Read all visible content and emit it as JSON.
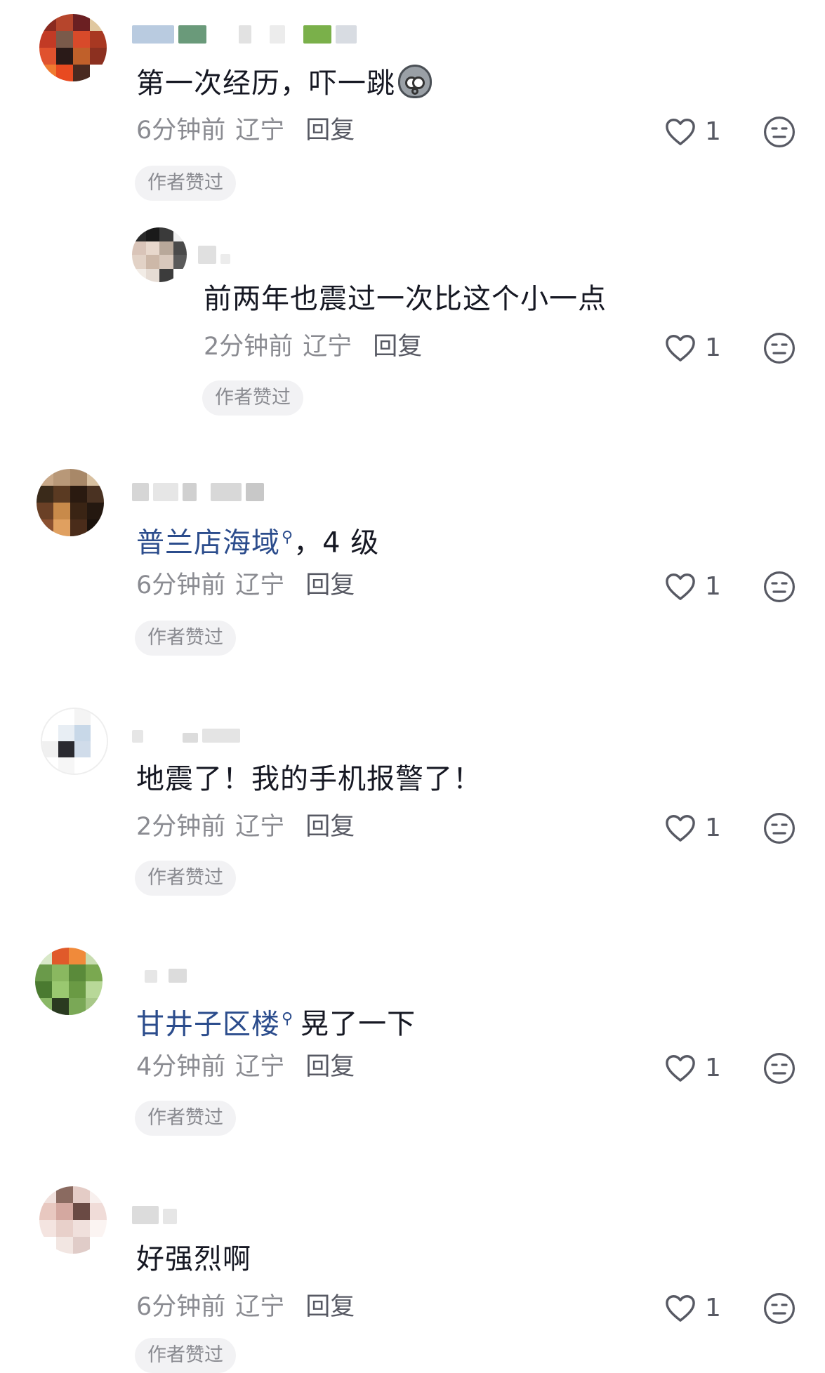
{
  "comments": [
    {
      "text": "第一次经历，吓一跳",
      "emoji_icon": "scared-face-emoji",
      "time": "6分钟前",
      "location": "辽宁",
      "reply_label": "回复",
      "like_count": "1",
      "author_liked": "作者赞过"
    },
    {
      "text": "前两年也震过一次比这个小一点",
      "time": "2分钟前",
      "location": "辽宁",
      "reply_label": "回复",
      "like_count": "1",
      "author_liked": "作者赞过"
    },
    {
      "keyword": "普兰店海域",
      "text": "，4 级",
      "time": "6分钟前",
      "location": "辽宁",
      "reply_label": "回复",
      "like_count": "1",
      "author_liked": "作者赞过"
    },
    {
      "text": "地震了！我的手机报警了！",
      "time": "2分钟前",
      "location": "辽宁",
      "reply_label": "回复",
      "like_count": "1",
      "author_liked": "作者赞过"
    },
    {
      "keyword": "甘井子区楼",
      "text": "晃了一下",
      "time": "4分钟前",
      "location": "辽宁",
      "reply_label": "回复",
      "like_count": "1",
      "author_liked": "作者赞过"
    },
    {
      "text": "好强烈啊",
      "time": "6分钟前",
      "location": "辽宁",
      "reply_label": "回复",
      "like_count": "1",
      "author_liked": "作者赞过"
    }
  ],
  "icons": {
    "like": "heart-outline-icon",
    "dislike": "neutral-face-icon",
    "keyword_search": "search-icon"
  },
  "colors": {
    "keyword": "#2b4c8c",
    "meta": "#8a8b91",
    "badge_bg": "#f2f2f4"
  }
}
